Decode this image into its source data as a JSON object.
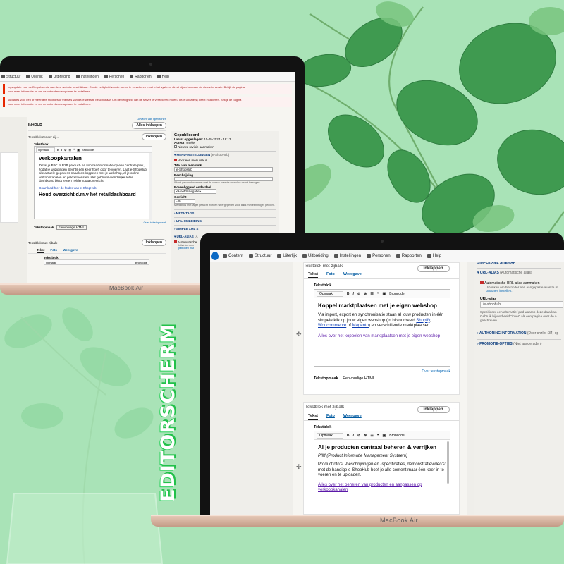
{
  "title": "EDITORSCHERM",
  "colors": {
    "background": "#a8e4b6",
    "accent_green": "#22c04a",
    "leaf": "#4fa25a",
    "toolbar_bg": "#f7f7f7",
    "link": "#0a3bb2",
    "error": "#a51b1b"
  },
  "back_laptop": {
    "brand": "MacBook Air",
    "toolbar": [
      {
        "icon": "grid-icon",
        "label": "Structuur"
      },
      {
        "icon": "brush-icon",
        "label": "Uiterlijk"
      },
      {
        "icon": "puzzle-icon",
        "label": "Uitbreiding"
      },
      {
        "icon": "wrench-icon",
        "label": "Instellingen"
      },
      {
        "icon": "person-icon",
        "label": "Personen"
      },
      {
        "icon": "chart-icon",
        "label": "Rapporten"
      },
      {
        "icon": "help-icon",
        "label": "Help"
      }
    ],
    "alerts": [
      "ingsupdate voor de Drupal-versie van deze website beschikbaar. Om de veiligheid van de server te verzekeren moet u het systeem direct bijwerken naar de nieuwste versie. Bekijk de pagina",
      "voor meer informatie en om de ontbrekende updates te installeren.",
      "supdates voor één of meerdere modules of thema's van deze website beschikbaar. Om de veiligheid van de server te verzekeren moet u deze update(s) direct installeren. Bekijk de pagina",
      "voor meer informatie en om de ontbrekende updates te installeren."
    ],
    "weight_link": "Gewicht van rijen tonen",
    "inhoud_label": "INHOUD",
    "collapse_all": "Alles inklappen",
    "block1_title": "Tekstblok zonder zij...",
    "collapse": "Inklappen",
    "field_label": "Tekstblok",
    "format_select": "Opmaak",
    "source_btn": "Broncode",
    "heading1": "verkoopkanalen",
    "body": "Zet al je B2C of B2B product- en voorraadinformatie op een centrale plek, zodat je wijzigingen slechts één keer hoeft door te voeren. Laat e-ShopHub alle actuele gegevens naadloos koppelen met je webshop, al je online verkoopkanalen en pakketdiensten. Het gebruiksvriendelijke retail dashboard biedt je een helder totaaloverzicht.",
    "download_link": "Download hier de folder van e-ShopHub",
    "heading2": "Houd overzicht d.m.v het retaildashboard",
    "text_format_label": "Tekstopmaak",
    "text_format_value": "Eenvoudige HTML",
    "about_format": "Over tekstopmaak",
    "block2_title": "Tekstblok met zijbalk",
    "tabs": [
      "Tekst",
      "Foto",
      "Weergave"
    ],
    "sidebar": {
      "status": "Gepubliceerd",
      "last_saved_label": "Laatst opgeslagen:",
      "last_saved": "10-05-2024 - 18:13",
      "author_label": "Auteur:",
      "author": "sneller",
      "new_revision": "Nieuwe revisie aanmaken",
      "menu_settings": "MENU-INSTELLINGEN",
      "menu_settings_note": "(e-ShopHub)",
      "provide_menu_link": "Voor een menulink in",
      "menu_title_label": "Titel van menulink",
      "menu_title": "e-ShopHub",
      "description_label": "Beschrijving",
      "description_help": "Wordt getoond wanneer met de cursor over de menulink wordt bewogen.",
      "parent_label": "Bovenliggend onderdeel",
      "parent_value": "<Hoofdnavigatie>",
      "weight_label": "Gewicht",
      "weight_value": "-49",
      "weight_help": "Menulinks met lager gewicht worden weergegeven voor links met een hoger gewicht.",
      "meta_tags": "META TAGS",
      "url_redirects": "URL-OMLEIDING",
      "simple_xml": "SIMPLE XML S",
      "url_alias": "URL-ALIAS",
      "url_alias_note": "(A",
      "auto_alias": "Automatische",
      "auto_alias_help_1": "Uitvinken om",
      "auto_alias_help_2": "patronen inst"
    }
  },
  "front_laptop": {
    "brand": "MacBook Air",
    "toolbar": [
      {
        "icon": "drupal-icon",
        "label": ""
      },
      {
        "icon": "content-icon",
        "label": "Content"
      },
      {
        "icon": "grid-icon",
        "label": "Structuur"
      },
      {
        "icon": "brush-icon",
        "label": "Uiterlijk"
      },
      {
        "icon": "puzzle-icon",
        "label": "Uitbreiding"
      },
      {
        "icon": "wrench-icon",
        "label": "Instellingen"
      },
      {
        "icon": "person-icon",
        "label": "Personen"
      },
      {
        "icon": "chart-icon",
        "label": "Rapporten"
      },
      {
        "icon": "help-icon",
        "label": "Help"
      }
    ],
    "block1": {
      "title": "Tekstblok met zijbalk",
      "collapse": "Inklappen",
      "tabs": [
        "Tekst",
        "Foto",
        "Weergave"
      ],
      "field_label": "Tekstblok",
      "format_select": "Opmaak",
      "source_btn": "Broncode",
      "heading": "Koppel marktplaatsen met je eigen webshop",
      "body_pre": "Via import, export en synchronisatie staan al jouw producten in één simpele klik op jouw eigen webshop (in bijvoorbeeld",
      "link_shopify": "Shopify",
      "sep1": ", ",
      "link_woo": "Woocommerce",
      "sep2": " of ",
      "link_magento": "Magento",
      "body_post": ") en verschillende marktplaatsen.",
      "link_more": "Alles over het koppelen van marktplaatsen met je eigen webshop",
      "about_format": "Over tekstopmaak",
      "text_format_label": "Tekstopmaak",
      "text_format_value": "Eenvoudige HTML"
    },
    "block2": {
      "title": "Tekstblok met zijbalk",
      "collapse": "Inklappen",
      "tabs": [
        "Tekst",
        "Foto",
        "Weergave"
      ],
      "field_label": "Tekstblok",
      "format_select": "Opmaak",
      "source_btn": "Broncode",
      "heading": "Al je producten centraal beheren & verrijken",
      "subtitle": "PIM (Product Informatie Management Systeem)",
      "body": "Productfoto's, -beschrijvingen en -specificaties, demonstratievideo's: met de handige e-ShopHub hoef je alle content maar één keer in te voeren en te uploaden.",
      "link_more": "Alles over het beheren van producten en aanpassen op verkoopkanalen"
    },
    "sidebar": {
      "top_cut": "SIMPLE XML SITEMAP",
      "url_alias": "URL-ALIAS",
      "url_alias_note": "(Automatische alias)",
      "auto_alias": "Automatische URL-alias aanmaken",
      "auto_alias_help_1": "Uitvinken om hieronder een aangepaste alias te m",
      "auto_alias_help_2": "patronen instellen.",
      "url_alias_label": "URL-alias",
      "url_alias_value": "/e-shophub",
      "alias_help": "Specificeer een alternatief pad waarop deze data kan Gebruik bijvoorbeeld \"/over\" als een pagina over de o geschreven.",
      "authoring": "AUTHORING INFORMATION",
      "authoring_note": "(Door snzler (34) op",
      "promotion": "PROMOTIE-OPTIES",
      "promotion_note": "(Niet aangeraden)"
    }
  }
}
